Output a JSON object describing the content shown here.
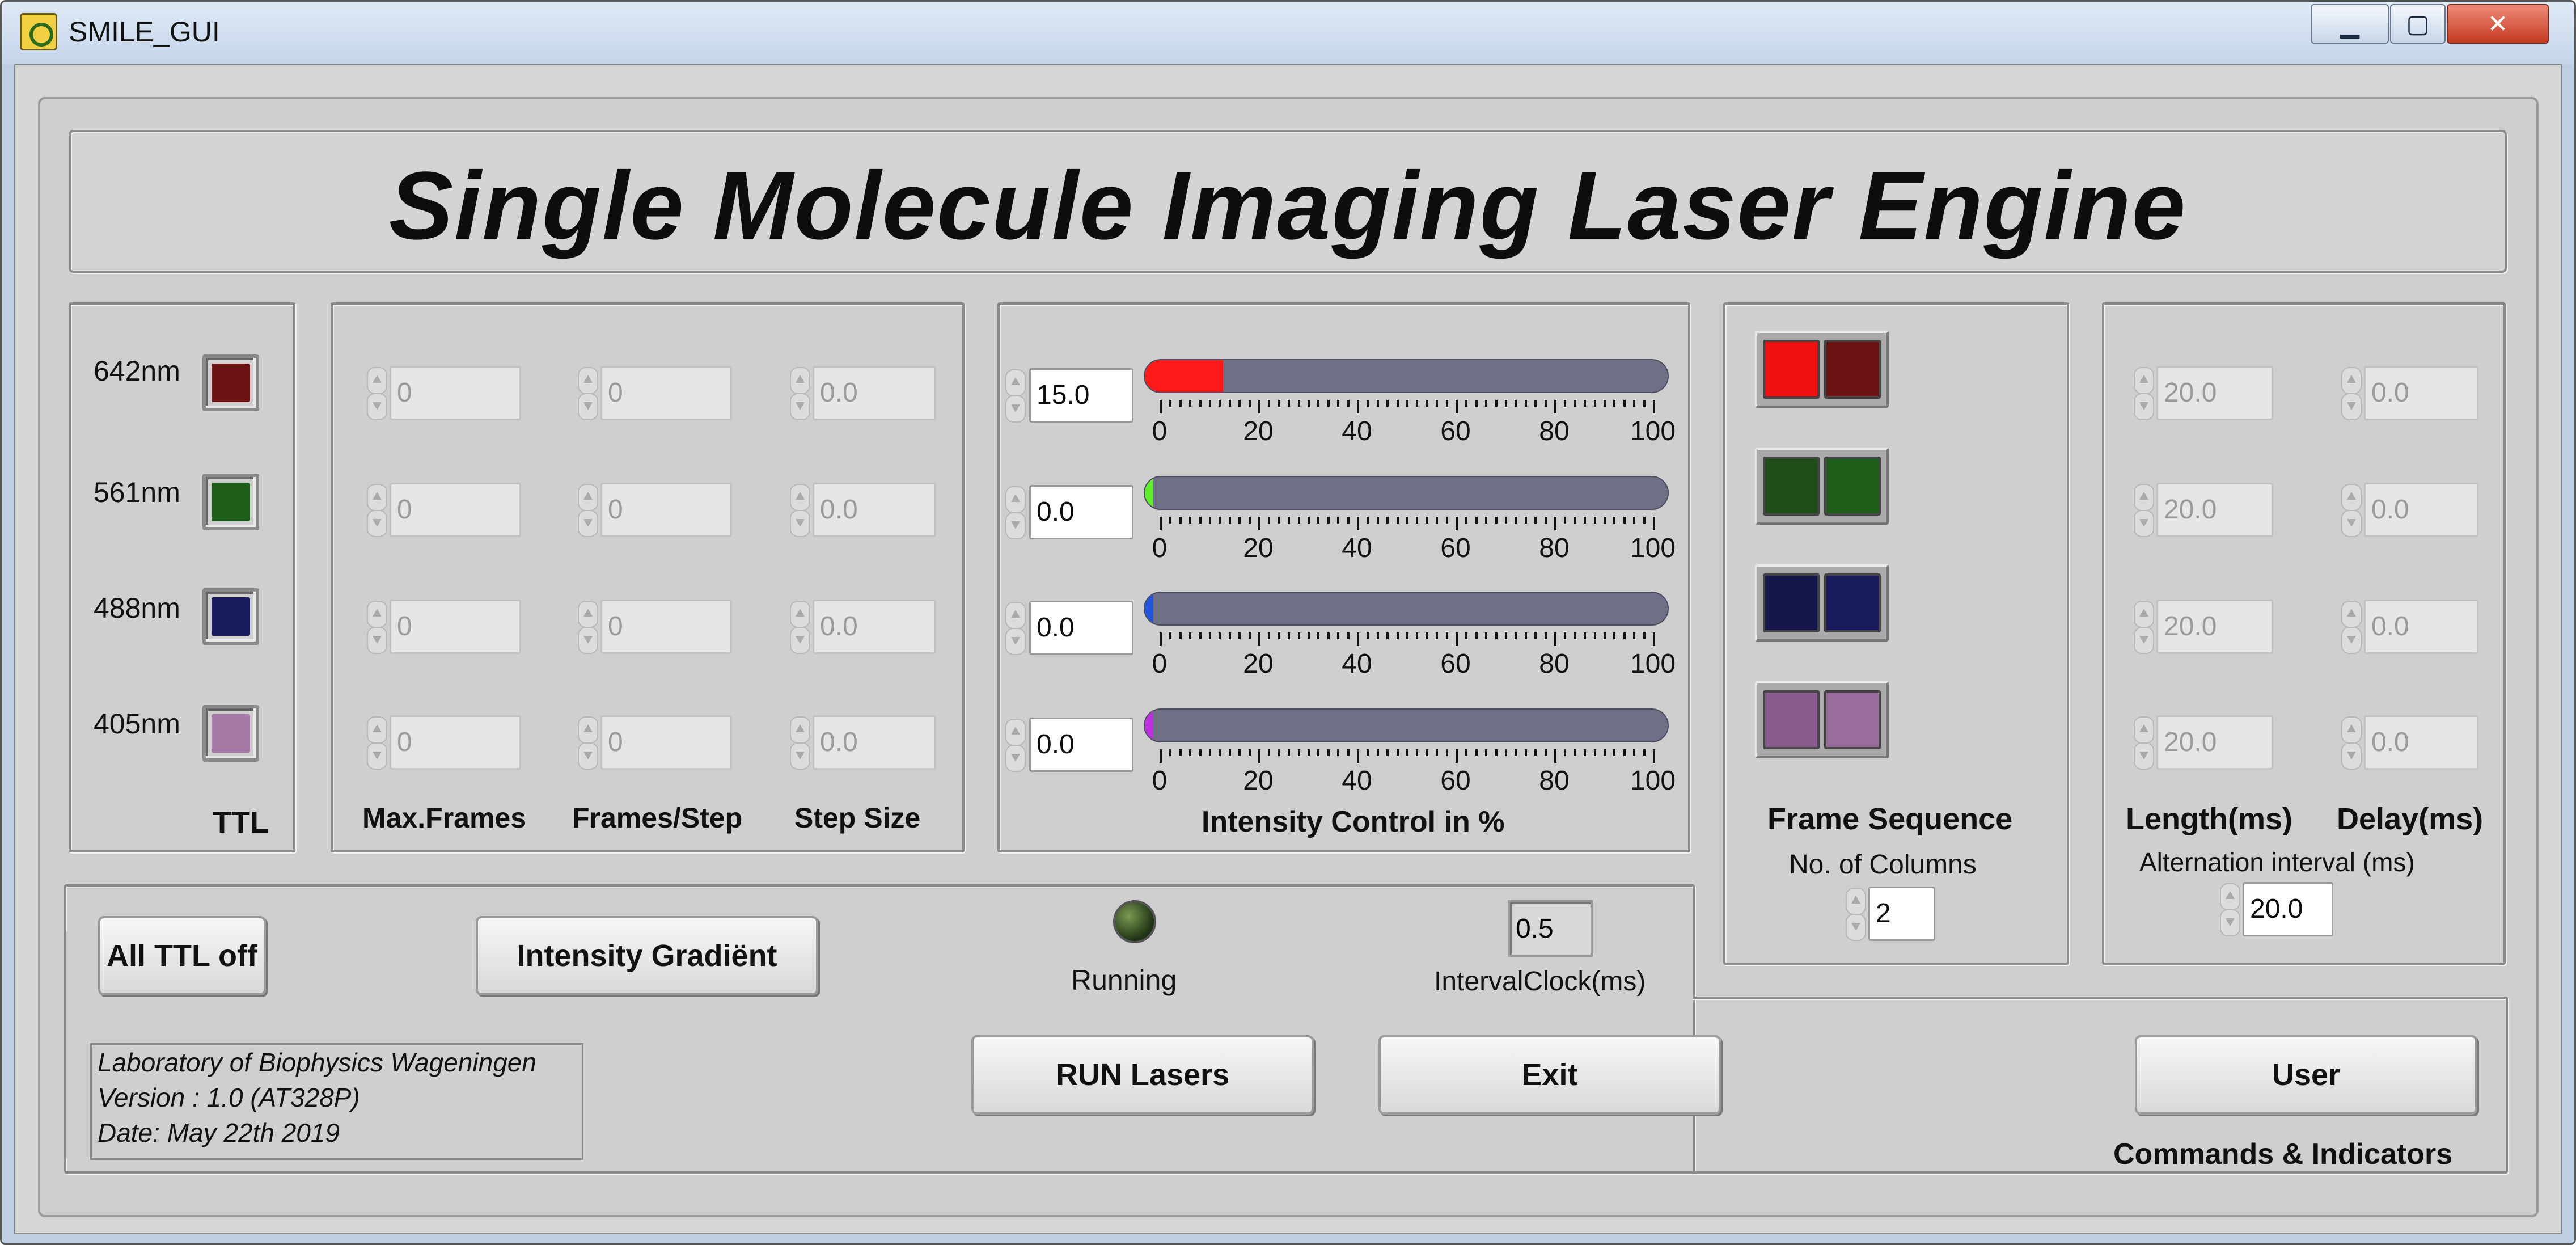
{
  "window": {
    "title": "SMILE_GUI",
    "minimize_glyph": "▁",
    "maximize_glyph": "▢",
    "close_glyph": "✕"
  },
  "banner": {
    "title": "Single Molecule Imaging Laser Engine"
  },
  "ttl_panel": {
    "title": "TTL",
    "lasers": [
      {
        "label": "642nm",
        "color": "#6a1212"
      },
      {
        "label": "561nm",
        "color": "#1f5e1a"
      },
      {
        "label": "488nm",
        "color": "#181a5c"
      },
      {
        "label": "405nm",
        "color": "#a57aa6"
      }
    ]
  },
  "steps_panel": {
    "headers": [
      "Max.Frames",
      "Frames/Step",
      "Step Size"
    ],
    "rows": [
      [
        "0",
        "0",
        "0.0"
      ],
      [
        "0",
        "0",
        "0.0"
      ],
      [
        "0",
        "0",
        "0.0"
      ],
      [
        "0",
        "0",
        "0.0"
      ]
    ]
  },
  "intensity_panel": {
    "title": "Intensity Control in %",
    "scale_labels": [
      "0",
      "20",
      "40",
      "60",
      "80",
      "100"
    ],
    "sliders": [
      {
        "value": "15.0",
        "percent": 15,
        "color": "#ff1a1a"
      },
      {
        "value": "0.0",
        "percent": 0,
        "color": "#5ef028"
      },
      {
        "value": "0.0",
        "percent": 0,
        "color": "#2255dd"
      },
      {
        "value": "0.0",
        "percent": 0,
        "color": "#c030e0"
      }
    ]
  },
  "frame_sequence": {
    "title": "Frame Sequence",
    "columns_label": "No. of Columns",
    "columns_value": "2",
    "rows": [
      {
        "left": "#f01010",
        "right": "#6a1212"
      },
      {
        "left": "#1f4e18",
        "right": "#1f5e1a"
      },
      {
        "left": "#16164c",
        "right": "#181a5c"
      },
      {
        "left": "#8a5a8c",
        "right": "#9a6e9c"
      }
    ]
  },
  "timing_panel": {
    "length_label": "Length(ms)",
    "delay_label": "Delay(ms)",
    "rows": [
      [
        "20.0",
        "0.0"
      ],
      [
        "20.0",
        "0.0"
      ],
      [
        "20.0",
        "0.0"
      ],
      [
        "20.0",
        "0.0"
      ]
    ],
    "alternation_label": "Alternation interval (ms)",
    "alternation_value": "20.0"
  },
  "commands": {
    "title": "Commands & Indicators",
    "all_ttl_off": "All TTL off",
    "intensity_gradient": "Intensity Gradiënt",
    "running_label": "Running",
    "interval_clock_label": "IntervalClock(ms)",
    "interval_clock_value": "0.5",
    "run_lasers": "RUN Lasers",
    "exit": "Exit",
    "user": "User",
    "info_lines": [
      "Laboratory of Biophysics Wageningen",
      "Version : 1.0 (AT328P)",
      "Date: May 22th 2019"
    ]
  }
}
